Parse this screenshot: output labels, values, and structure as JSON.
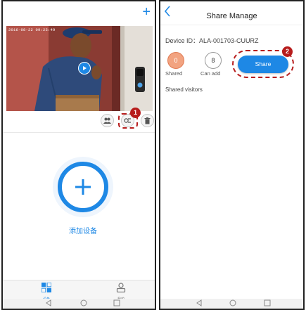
{
  "left_screen": {
    "video": {
      "timestamp": "2016-08-22 09:25:49"
    },
    "annotation_badge": "1",
    "add_device_label": "添加设备",
    "tabs": [
      {
        "label": "设备",
        "icon": "grid-icon",
        "active": true
      },
      {
        "label": "我的",
        "icon": "person-icon",
        "active": false
      }
    ]
  },
  "right_screen": {
    "title": "Share Manage",
    "device_id": "Device ID：ALA-001703-CUURZ",
    "shared": {
      "count": "0",
      "label": "Shared"
    },
    "can_add": {
      "count": "8",
      "label": "Can add"
    },
    "share_button": "Share",
    "annotation_badge": "2",
    "shared_visitors_label": "Shared visitors"
  },
  "colors": {
    "accent": "#1e88e5",
    "annotation": "#b71c1c",
    "shared_circle": "#f2a380"
  }
}
